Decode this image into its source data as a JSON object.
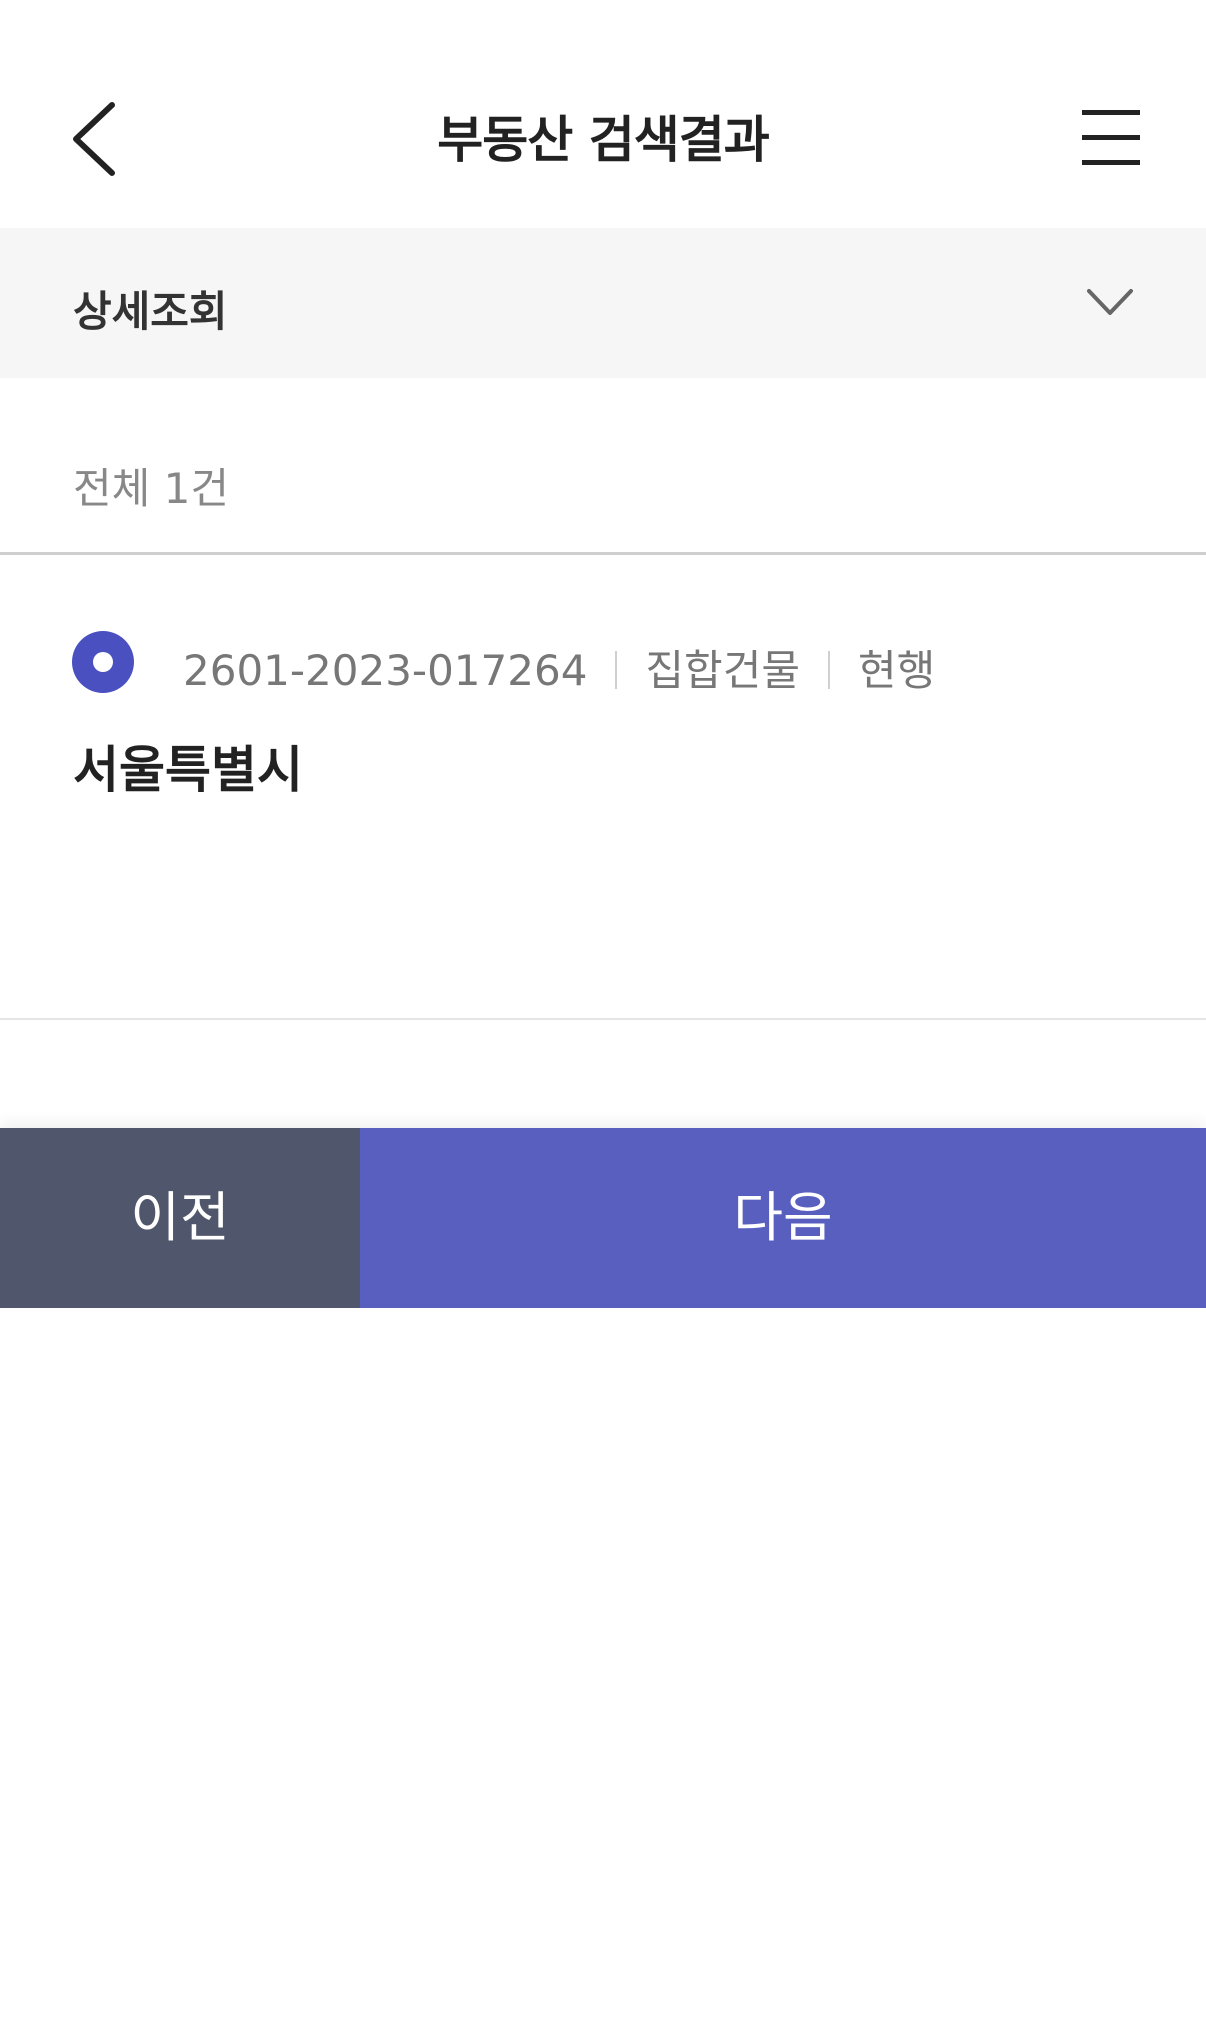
{
  "header": {
    "title": "부동산 검색결과",
    "back_icon": "chevron-left-icon",
    "menu_icon": "hamburger-menu-icon"
  },
  "detail": {
    "label": "상세조회",
    "icon": "chevron-down-icon"
  },
  "results": {
    "total": "전체 1건",
    "items": [
      {
        "selected": true,
        "number": "2601-2023-017264",
        "type": "집합건물",
        "status": "현행",
        "address_line1": "서울특별시",
        "address_line2": ""
      }
    ]
  },
  "buttons": {
    "prev_label": "이전",
    "next_label": "다음"
  },
  "colors": {
    "accent": "#585fbf",
    "secondary_button": "#50566b",
    "radio": "#4a50c0"
  }
}
